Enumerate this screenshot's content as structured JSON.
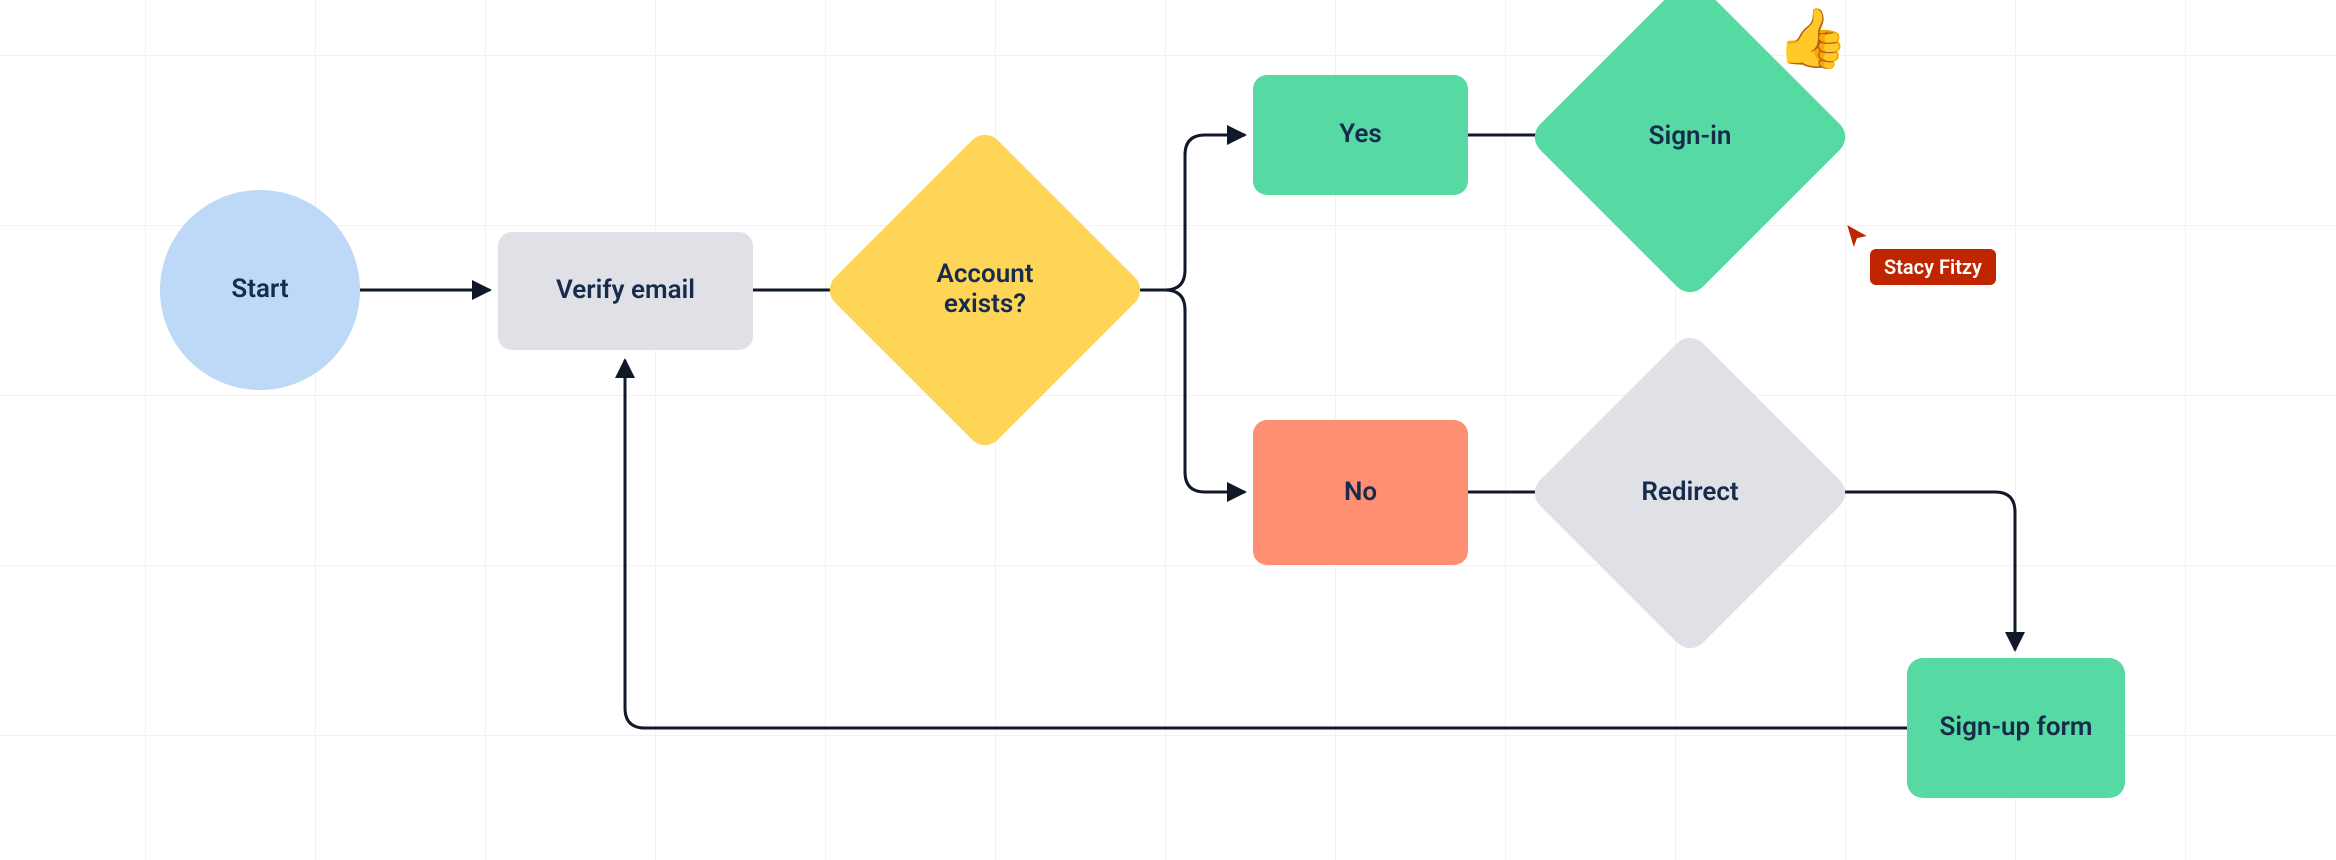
{
  "nodes": {
    "start": {
      "label": "Start",
      "type": "terminator",
      "color": "#bed8f7"
    },
    "verify": {
      "label": "Verify email",
      "type": "process",
      "color": "#dfe1e7"
    },
    "account_exists": {
      "label": "Account exists?",
      "type": "decision",
      "color": "#ffd558"
    },
    "yes": {
      "label": "Yes",
      "type": "process",
      "color": "#57d9a3"
    },
    "no": {
      "label": "No",
      "type": "process",
      "color": "#ff8f73"
    },
    "signin": {
      "label": "Sign-in",
      "type": "decision",
      "color": "#57d9a3"
    },
    "redirect": {
      "label": "Redirect",
      "type": "decision",
      "color": "#dfe1e7"
    },
    "signup": {
      "label": "Sign-up form",
      "type": "process",
      "color": "#57d9a3"
    }
  },
  "edges": [
    {
      "from": "start",
      "to": "verify"
    },
    {
      "from": "verify",
      "to": "account_exists"
    },
    {
      "from": "account_exists",
      "to": "yes"
    },
    {
      "from": "account_exists",
      "to": "no"
    },
    {
      "from": "yes",
      "to": "signin"
    },
    {
      "from": "no",
      "to": "redirect"
    },
    {
      "from": "redirect",
      "to": "signup"
    },
    {
      "from": "signup",
      "to": "verify"
    }
  ],
  "sticker": {
    "emoji": "👍",
    "name": "thumbs-up"
  },
  "collaborator": {
    "name": "Stacy Fitzy",
    "color": "#bf2600"
  }
}
